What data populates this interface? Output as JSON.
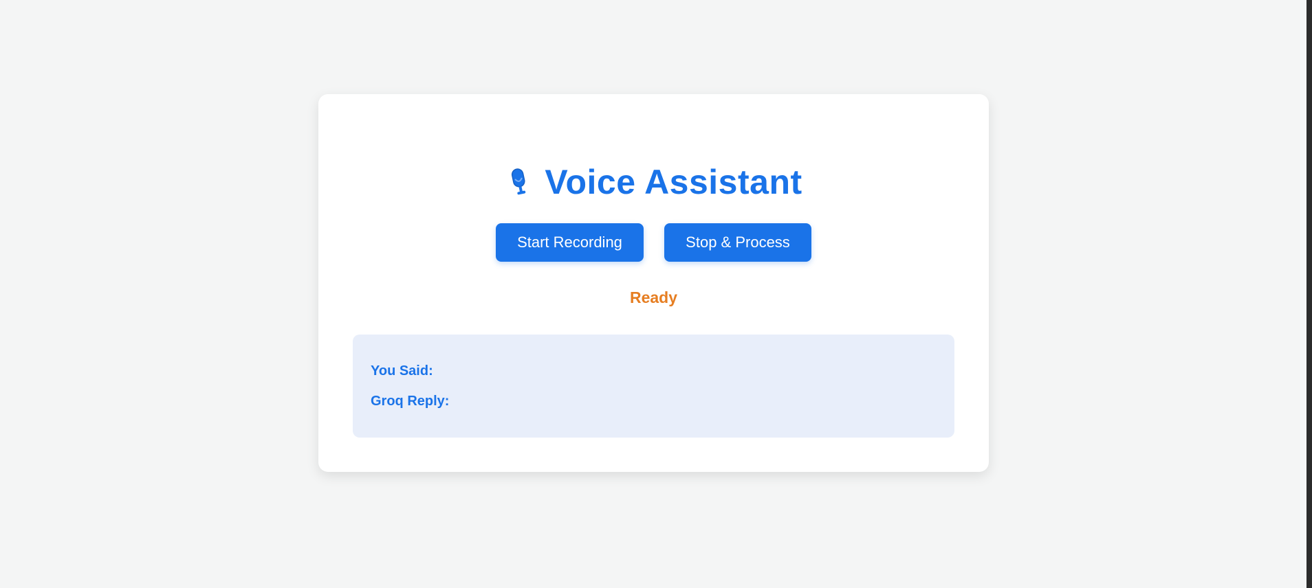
{
  "app": {
    "title": "Voice Assistant",
    "title_icon": "microphone-icon"
  },
  "controls": {
    "start_label": "Start Recording",
    "stop_label": "Stop & Process"
  },
  "status": {
    "text": "Ready",
    "color": "#e67e22"
  },
  "output": {
    "you_said_label": "You Said:",
    "you_said_value": "",
    "reply_label": "Groq Reply:",
    "reply_value": ""
  },
  "colors": {
    "accent": "#1a73e8",
    "background": "#f4f5f5",
    "card": "#ffffff",
    "output_panel": "#e8eefa"
  }
}
